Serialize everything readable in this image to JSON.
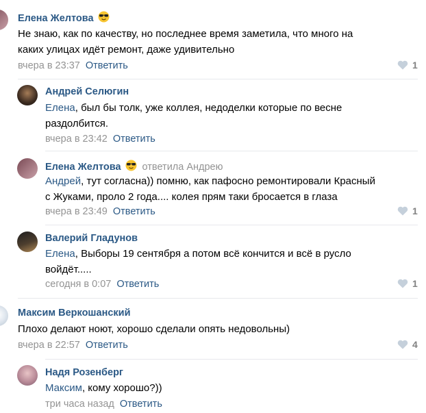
{
  "colors": {
    "link": "#2a5885",
    "meta": "#939393",
    "divider": "#e7e8ec",
    "like": "#b5bcc6"
  },
  "reply_label": "Ответить",
  "comments": [
    {
      "author": "Елена Желтова",
      "emoji": "smiling-face-with-sunglasses",
      "text_lines": [
        "Не знаю, как по качеству, но последнее время заметила, что много на",
        "каких улицах идёт ремонт, даже удивительно"
      ],
      "time": "вчера в 23:37",
      "likes": "1"
    },
    {
      "author": "Андрей Селюгин",
      "mention": "Елена",
      "text_lines": [
        ", был бы толк, уже коллея, недоделки которые по весне",
        "раздолбится."
      ],
      "time": "вчера в 23:42"
    },
    {
      "author": "Елена Желтова",
      "emoji": "smiling-face-with-sunglasses",
      "replied_to": "ответила Андрею",
      "mention": "Андрей",
      "text_lines": [
        ", тут согласна)) помню, как пафосно ремонтировали Красный",
        "с Жуками, проло 2 года.... колея прям таки бросается в глаза"
      ],
      "time": "вчера в 23:49",
      "likes": "1"
    },
    {
      "author": "Валерий Гладунов",
      "mention": "Елена",
      "text_lines": [
        ", Выборы 19 сентября а потом всё кончится и всё в русло",
        "войдёт....."
      ],
      "time": "сегодня в 0:07",
      "likes": "1"
    },
    {
      "author": "Максим Веркошанский",
      "text_lines": [
        "Плохо делают ноют, хорошо сделали опять недовольны)"
      ],
      "time": "вчера в 22:57",
      "likes": "4"
    },
    {
      "author": "Надя Розенберг",
      "mention": "Максим",
      "text_lines": [
        ", кому хорошо?))"
      ],
      "time": "три часа назад"
    }
  ]
}
